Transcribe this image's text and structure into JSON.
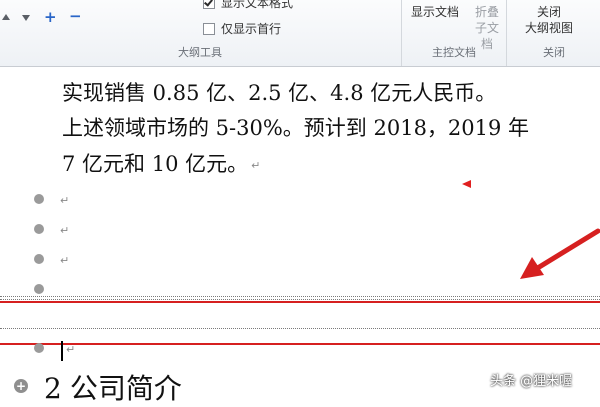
{
  "ribbon": {
    "outline_group": {
      "label": "大纲工具",
      "show_text_format": "显示文本格式",
      "show_first_line_only": "仅显示首行",
      "promote_symbol": "+",
      "demote_symbol": "−"
    },
    "master_group": {
      "label": "主控文档",
      "show_document": "显示文档",
      "collapse_line1": "折叠",
      "collapse_line2": "子文档"
    },
    "close_group": {
      "label": "关闭",
      "close_line1": "关闭",
      "close_line2": "大纲视图"
    }
  },
  "document": {
    "line1": "实现销售 0.85 亿、2.5 亿、4.8 亿元人民币。",
    "line2": "上述领域市场的 5-30%。预计到 2018，2019 年",
    "line3": "7 亿元和 10 亿元。",
    "para_mark": "↵",
    "heading_num": "2",
    "heading_text": "公司简介"
  },
  "watermark": "头条 @狸米喔",
  "colors": {
    "annotation_red": "#d62020",
    "accent_blue": "#2a66c8"
  }
}
